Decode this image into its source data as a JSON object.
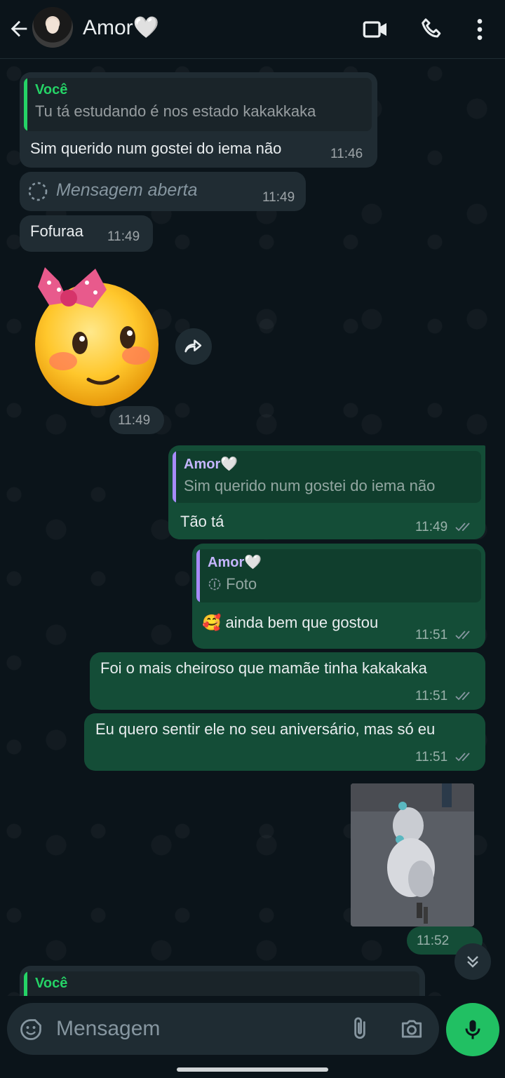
{
  "header": {
    "contact_name": "Amor🤍"
  },
  "messages": {
    "m1": {
      "quote_author": "Você",
      "quote_text": "Tu tá estudando é nos estado kakakkaka",
      "text": "Sim querido num gostei do iema não",
      "time": "11:46"
    },
    "m2": {
      "text": "Mensagem aberta",
      "time": "11:49"
    },
    "m3": {
      "text": "Fofuraa",
      "time": "11:49"
    },
    "m4": {
      "time": "11:49"
    },
    "m5": {
      "quote_author": "Amor🤍",
      "quote_text": "Sim querido num gostei do iema não",
      "text": "Tão tá",
      "time": "11:49"
    },
    "m6": {
      "quote_author": "Amor🤍",
      "quote_text": "Foto",
      "emoji": "🥰",
      "text": "ainda bem que gostou",
      "time": "11:51"
    },
    "m7": {
      "text": "Foi o mais cheiroso que mamãe tinha kakakaka",
      "time": "11:51"
    },
    "m8": {
      "text": "Eu quero sentir ele no seu aniversário, mas só eu",
      "time": "11:51"
    },
    "m9": {
      "time": "11:52"
    },
    "m10": {
      "quote_author": "Você"
    }
  },
  "input": {
    "placeholder": "Mensagem"
  },
  "colors": {
    "background": "#0b141a",
    "incoming_bubble": "#202c33",
    "outgoing_bubble": "#144d37",
    "accent_green": "#25d366",
    "quote_purple": "#c4b5fd"
  }
}
